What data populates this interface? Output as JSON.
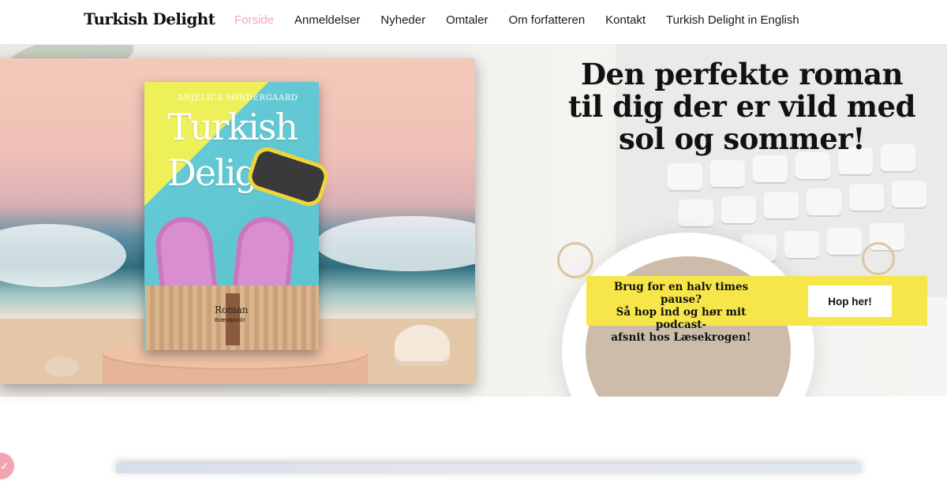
{
  "header": {
    "logo": "Turkish Delight",
    "nav": [
      {
        "label": "Forside",
        "active": true
      },
      {
        "label": "Anmeldelser"
      },
      {
        "label": "Nyheder"
      },
      {
        "label": "Omtaler"
      },
      {
        "label": "Om forfatteren"
      },
      {
        "label": "Kontakt"
      },
      {
        "label": "Turkish Delight in English"
      }
    ],
    "active_color": "#f2a7b4"
  },
  "hero": {
    "headline_lines": [
      "Den perfekte roman",
      "til dig der er vild med",
      "sol og sommer!"
    ],
    "book": {
      "author": "ANJELICA SØNDERGAARD",
      "title_line1": "Turkish",
      "title_line2": "Delight",
      "genre": "Roman",
      "publisher": "Brændpunkt"
    },
    "banner": {
      "text_lines": [
        "Brug for en halv times pause?",
        "Så hop ind og hør mit podcast-",
        "afsnit hos Læsekrogen!"
      ],
      "button_label": "Hop her!",
      "background": "#f7e64a"
    }
  },
  "icons": {
    "badge": "check-icon"
  }
}
